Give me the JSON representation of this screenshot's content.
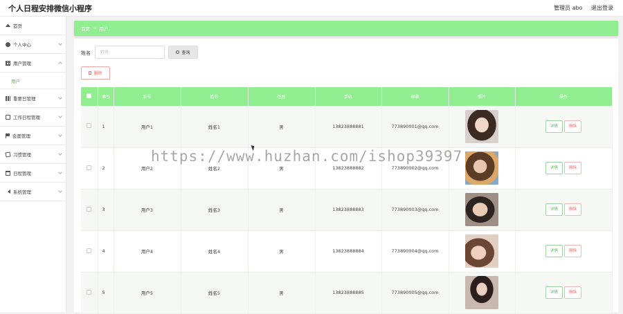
{
  "app": {
    "title": "个人日程安排微信小程序",
    "admin_label": "管理员 abo",
    "logout_label": "退出登录"
  },
  "sidebar": {
    "items": [
      {
        "label": "首页",
        "icon": "home-icon"
      },
      {
        "label": "个人中心",
        "icon": "user-icon"
      },
      {
        "label": "用户管理",
        "icon": "grid-icon"
      },
      {
        "label": "重要日管理",
        "icon": "bar-chart-icon"
      },
      {
        "label": "工作日程管理",
        "icon": "message-icon"
      },
      {
        "label": "会面管理",
        "icon": "flag-icon"
      },
      {
        "label": "习惯管理",
        "icon": "edit-icon"
      },
      {
        "label": "日程管理",
        "icon": "calendar-icon"
      },
      {
        "label": "系统管理",
        "icon": "send-icon"
      }
    ],
    "sub_item": "用户"
  },
  "breadcrumb": {
    "home": "首页",
    "sep": "→",
    "current": "用户"
  },
  "search": {
    "label": "姓名",
    "placeholder": "姓名",
    "button": "查询"
  },
  "toolbar": {
    "delete_label": "删除"
  },
  "table": {
    "headers": [
      "索引",
      "账号",
      "姓名",
      "性别",
      "手机",
      "邮箱",
      "照片",
      "操作"
    ],
    "rows": [
      {
        "index": "1",
        "account": "用户1",
        "name": "姓名1",
        "gender": "男",
        "phone": "13823888881",
        "email": "773890001@qq.com",
        "photo": "photo-1"
      },
      {
        "index": "2",
        "account": "用户2",
        "name": "姓名2",
        "gender": "男",
        "phone": "13823888882",
        "email": "773890002@qq.com",
        "photo": "photo-2"
      },
      {
        "index": "3",
        "account": "用户3",
        "name": "姓名3",
        "gender": "男",
        "phone": "13823888883",
        "email": "773890003@qq.com",
        "photo": "photo-3"
      },
      {
        "index": "4",
        "account": "用户4",
        "name": "姓名4",
        "gender": "男",
        "phone": "13823888884",
        "email": "773890004@qq.com",
        "photo": "photo-4"
      },
      {
        "index": "5",
        "account": "用户5",
        "name": "姓名5",
        "gender": "男",
        "phone": "13823888885",
        "email": "773890005@qq.com",
        "photo": "photo-5"
      }
    ],
    "actions": {
      "detail": "详情",
      "delete": "删除"
    }
  },
  "watermark": "https://www.huzhan.com/ishop39397",
  "colors": {
    "accent": "#90ee90",
    "danger": "#f56c6c",
    "active": "#5cb85c"
  }
}
